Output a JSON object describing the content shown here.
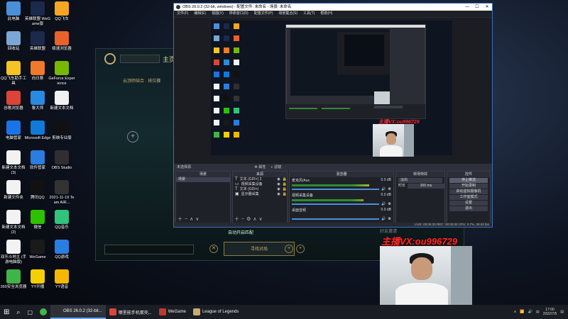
{
  "desktop": {
    "icons": [
      {
        "label": "此电脑",
        "color": "#4a90d9"
      },
      {
        "label": "英雄联盟 WeGame版",
        "color": "#1b2a4a"
      },
      {
        "label": "QQ飞车",
        "color": "#f5a623"
      },
      {
        "label": "回收站",
        "color": "#7aa7d6"
      },
      {
        "label": "英雄联盟",
        "color": "#1b2a4a"
      },
      {
        "label": "极速浏览器",
        "color": "#e8622a"
      },
      {
        "label": "QQ飞车助手工具",
        "color": "#f5c323"
      },
      {
        "label": "向日葵",
        "color": "#f07a2a"
      },
      {
        "label": "GeForce Experience",
        "color": "#76b900"
      },
      {
        "label": "谷歌浏览器",
        "color": "#db4437"
      },
      {
        "label": "鲁大师",
        "color": "#2a8adf"
      },
      {
        "label": "新建文本文档",
        "color": "#f2f2f2"
      },
      {
        "label": "电脑管家",
        "color": "#1a73e8"
      },
      {
        "label": "Microsoft Edge",
        "color": "#0f7ad8"
      },
      {
        "label": "剪映专业版",
        "color": "#111111"
      },
      {
        "label": "新建文本文档 (3)",
        "color": "#f2f2f2"
      },
      {
        "label": "软件管家",
        "color": "#2a7de1"
      },
      {
        "label": "OBS Studio",
        "color": "#302e31"
      },
      {
        "label": "新建文件夹",
        "color": "#f2f2f2"
      },
      {
        "label": "腾讯QQ",
        "color": "#111111"
      },
      {
        "label": "2021-11-19 Team AIR...",
        "color": "#333333"
      },
      {
        "label": "新建文本文档 (2)",
        "color": "#f2f2f2"
      },
      {
        "label": "微信",
        "color": "#2dc100"
      },
      {
        "label": "QQ音乐",
        "color": "#31c27c"
      },
      {
        "label": "双乐斗地主 (手游电脑版)",
        "color": "#f2f2f2"
      },
      {
        "label": "WeGame",
        "color": "#1a1a1a"
      },
      {
        "label": "QQ游戏",
        "color": "#2a7de1"
      },
      {
        "label": "360安全浏览器",
        "color": "#3fb549"
      },
      {
        "label": "YY开播",
        "color": "#f5d000"
      },
      {
        "label": "YY语音",
        "color": "#f5b800"
      }
    ]
  },
  "lol": {
    "title": "主页",
    "subtitle": "云顶师结合 · 排位赛",
    "find_match": "寻找对局",
    "auto_accept": "自动开启匹配",
    "chat_hint": "好友邀请"
  },
  "obs": {
    "title": "OBS 26.0.2 (32-bit, windows) - 配置文件: 未命名 - 场景: 未命名",
    "menu": [
      "文件(F)",
      "编辑(E)",
      "视图(V)",
      "停靠窗口(D)",
      "配置文件(P)",
      "场景集合(S)",
      "工具(T)",
      "帮助(H)"
    ],
    "scene_strip": "未选择源",
    "scene_strip_props": "属性",
    "scene_strip_filters": "滤镜",
    "scenes_header": "场景",
    "scenes": [
      "场景"
    ],
    "sources_header": "来源",
    "sources": [
      {
        "label": "文本 (GDI+) 2",
        "type": "T"
      },
      {
        "label": "视频采集设备",
        "type": "cam"
      },
      {
        "label": "文本 (GDI+)",
        "type": "T"
      },
      {
        "label": "显示器采集",
        "type": "mon"
      }
    ],
    "mixer_header": "混音器",
    "mixer": [
      {
        "name": "麦克风/Aux",
        "db": "0.0 dB",
        "level": 0.78
      },
      {
        "name": "视频采集设备",
        "db": "0.0 dB",
        "level": 0.72
      },
      {
        "name": "桌面音频",
        "db": "0.0 dB",
        "level": 0.0
      }
    ],
    "transition_header": "转场特效",
    "transition_type": "淡出",
    "transition_duration_label": "时长",
    "transition_duration": "300 ms",
    "controls_header": "控件",
    "controls": [
      "停止推流",
      "开始录制",
      "启动虚拟摄像机",
      "工作室模式",
      "设置",
      "退出"
    ],
    "status": "LIVE: 00:09:30   REC: 00:00:00   CPU: 0.7%, 30.00 fps"
  },
  "overlay": {
    "watermark": "主播VX:ou996729",
    "mini_watermark": "主播VX:ou996729"
  },
  "taskbar": {
    "items": [
      {
        "label": "OBS 26.0.2 (32-bit...",
        "color": "#302e31",
        "active": true
      },
      {
        "label": "哪里能手机蛋壳...",
        "color": "#db4437",
        "active": false
      },
      {
        "label": "WeGame",
        "color": "#c0392b",
        "active": false
      },
      {
        "label": "League of Legends",
        "color": "#c8aa6e",
        "active": false
      }
    ],
    "time": "17:00",
    "date": "2022/7/5",
    "ime": "中"
  }
}
